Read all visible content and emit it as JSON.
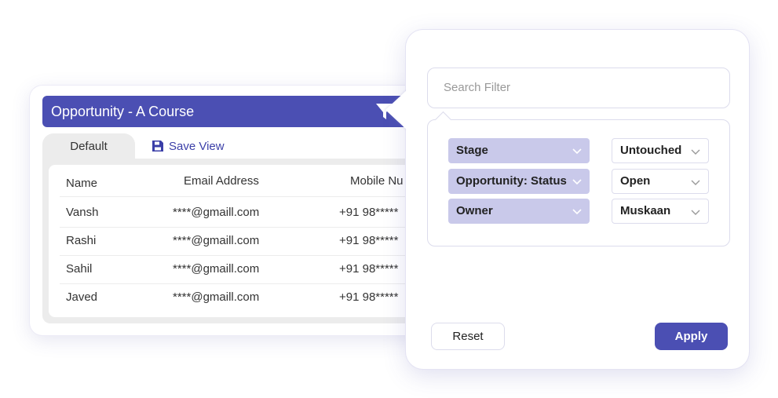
{
  "table_card": {
    "title": "Opportunity - A Course",
    "tabs": {
      "default": "Default",
      "save_view": "Save View"
    },
    "columns": [
      "Name",
      "Email Address",
      "Mobile Nu"
    ],
    "rows": [
      {
        "name": "Vansh",
        "email": "****@gmaill.com",
        "mobile": "+91 98*****"
      },
      {
        "name": "Rashi",
        "email": "****@gmaill.com",
        "mobile": "+91 98*****"
      },
      {
        "name": "Sahil",
        "email": "****@gmaill.com",
        "mobile": "+91 98*****"
      },
      {
        "name": "Javed",
        "email": "****@gmaill.com",
        "mobile": "+91 98*****"
      }
    ]
  },
  "filter_panel": {
    "search_placeholder": "Search Filter",
    "filters": [
      {
        "field": "Stage",
        "value": "Untouched"
      },
      {
        "field": "Opportunity: Status",
        "value": "Open"
      },
      {
        "field": "Owner",
        "value": "Muskaan"
      }
    ],
    "reset_label": "Reset",
    "apply_label": "Apply"
  },
  "icons": {
    "filter": "filter-funnel-icon",
    "save": "floppy-disk-icon",
    "chevron": "chevron-down-icon"
  },
  "colors": {
    "brand": "#4b4fb3",
    "field_bg": "#c9c9ea",
    "tab_bg": "#ececec"
  }
}
